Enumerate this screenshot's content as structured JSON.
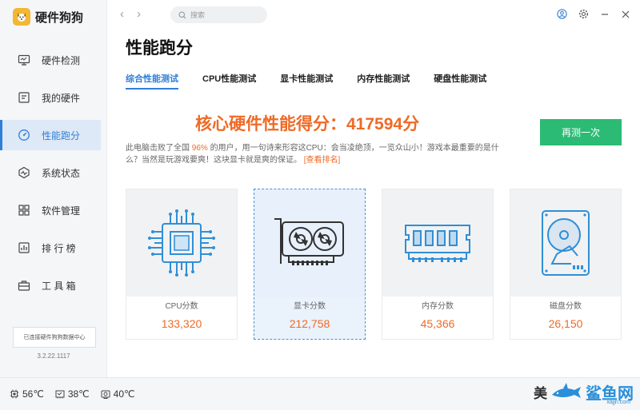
{
  "app": {
    "name": "硬件狗狗",
    "version": "3.2.22.1117",
    "connection_status": "已连接硬件狗狗数据中心"
  },
  "sidebar": {
    "items": [
      {
        "label": "硬件检测",
        "icon": "monitor-icon"
      },
      {
        "label": "我的硬件",
        "icon": "hardware-icon"
      },
      {
        "label": "性能跑分",
        "icon": "speedometer-icon",
        "active": true
      },
      {
        "label": "系统状态",
        "icon": "pulse-icon"
      },
      {
        "label": "软件管理",
        "icon": "apps-icon"
      },
      {
        "label": "排 行 榜",
        "icon": "ranking-icon"
      },
      {
        "label": "工 具 箱",
        "icon": "toolbox-icon"
      }
    ]
  },
  "topbar": {
    "search_placeholder": "搜索"
  },
  "page": {
    "title": "性能跑分",
    "tabs": [
      {
        "label": "综合性能测试",
        "active": true
      },
      {
        "label": "CPU性能测试"
      },
      {
        "label": "显卡性能测试"
      },
      {
        "label": "内存性能测试"
      },
      {
        "label": "硬盘性能测试"
      }
    ],
    "score_text": "核心硬件性能得分：417594分",
    "retest_label": "再测一次",
    "description": {
      "part1": "此电脑击败了全国 ",
      "percent": "96%",
      "part2": " 的用户，用一句诗来形容这CPU：会当凌绝顶，一览众山小！游戏本最重要的是什么？当然是玩游戏要爽！这块显卡就是爽的保证。",
      "link": "[查看排名]"
    },
    "cards": [
      {
        "label": "CPU分数",
        "value": "133,320",
        "icon": "cpu-icon"
      },
      {
        "label": "显卡分数",
        "value": "212,758",
        "icon": "gpu-icon",
        "selected": true
      },
      {
        "label": "内存分数",
        "value": "45,366",
        "icon": "ram-icon"
      },
      {
        "label": "磁盘分数",
        "value": "26,150",
        "icon": "hdd-icon"
      }
    ]
  },
  "status": {
    "temps": [
      {
        "value": "56℃",
        "icon": "cpu-temp-icon"
      },
      {
        "value": "38℃",
        "icon": "gpu-temp-icon"
      },
      {
        "value": "40℃",
        "icon": "disk-temp-icon"
      }
    ]
  },
  "watermark": {
    "text": "美",
    "brand": "鲨鱼网",
    "url": "xajjn.com"
  },
  "colors": {
    "accent": "#2f7fd8",
    "score": "#ef6a26",
    "button": "#2bbb74",
    "icon_line": "#2f8fd6"
  }
}
